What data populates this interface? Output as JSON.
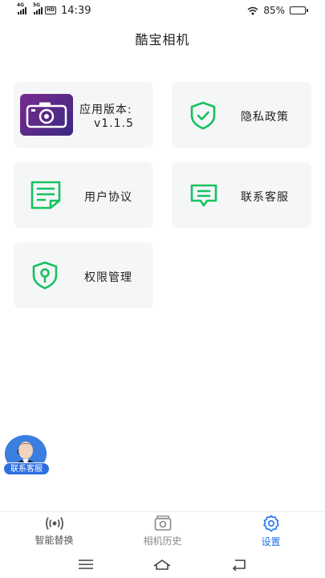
{
  "status_bar": {
    "network1": "4G",
    "network2": "5G",
    "hd": "HD",
    "time": "14:39",
    "battery_pct": "85%",
    "battery_level": 0.85
  },
  "title": "酷宝相机",
  "cards": {
    "version_label": "应用版本:",
    "version_value": "v1.1.5",
    "privacy": "隐私政策",
    "agreement": "用户协议",
    "contact": "联系客服",
    "permission": "权限管理"
  },
  "float_button": {
    "label": "联系客服"
  },
  "tabs": [
    {
      "label": "智能替换",
      "icon": "broadcast-icon"
    },
    {
      "label": "相机历史",
      "icon": "photo-history-icon"
    },
    {
      "label": "设置",
      "icon": "settings-gear-icon"
    }
  ],
  "colors": {
    "accent": "#1e6ff0",
    "icon_green": "#16c25f",
    "card_bg": "#f5f6f8"
  }
}
